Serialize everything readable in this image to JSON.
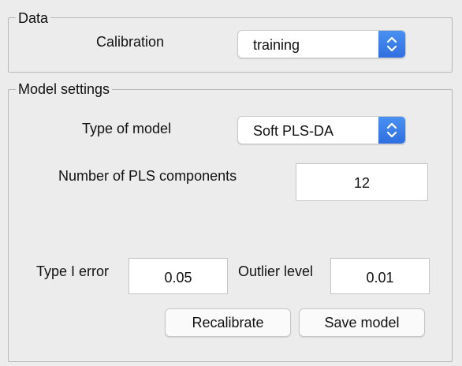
{
  "data_panel": {
    "title": "Data",
    "calibration_label": "Calibration",
    "calibration_value": "training"
  },
  "model_panel": {
    "title": "Model settings",
    "type_label": "Type of model",
    "type_value": "Soft PLS-DA",
    "components_label": "Number of PLS components",
    "components_value": "12",
    "type1_label": "Type I error",
    "type1_value": "0.05",
    "outlier_label": "Outlier level",
    "outlier_value": "0.01",
    "recalibrate_label": "Recalibrate",
    "save_label": "Save model"
  },
  "icons": {
    "select_arrows": "up-down-chevron-icon"
  },
  "colors": {
    "accent": "#3b7ff0",
    "background": "#ececec"
  }
}
